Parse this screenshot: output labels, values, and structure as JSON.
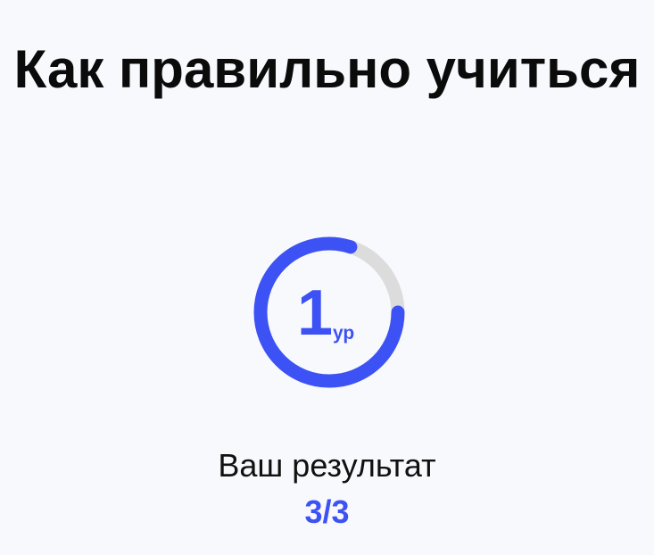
{
  "title": "Как правильно учиться",
  "level": {
    "number": "1",
    "unit": "ур",
    "progress": 0.8,
    "colors": {
      "progress": "#3d52f5",
      "track": "#dcdcdc",
      "text": "#3d52f5"
    }
  },
  "result": {
    "label": "Ваш результат",
    "score": "3/3"
  }
}
